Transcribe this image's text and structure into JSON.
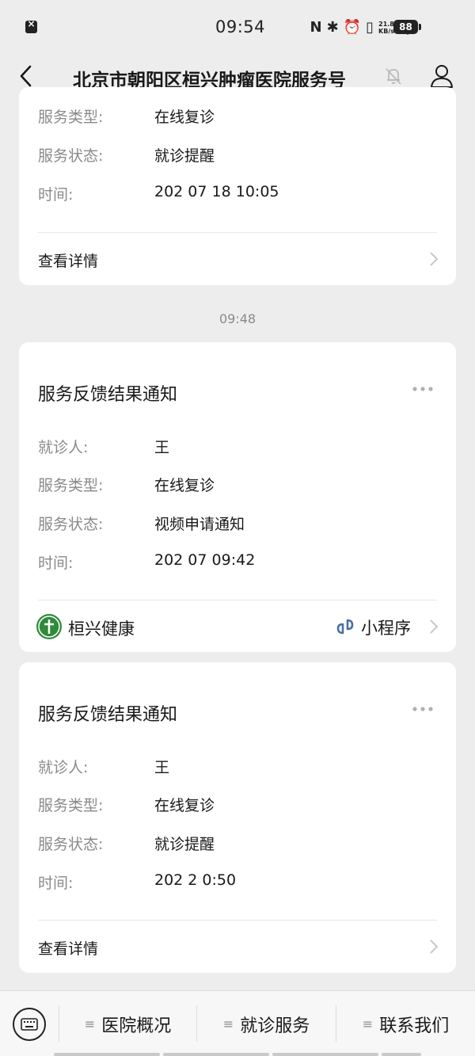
{
  "status_bar": {
    "time": "09:54",
    "network_speed": "21.8",
    "network_unit": "KB/s",
    "battery": "88"
  },
  "nav": {
    "title": "北京市朝阳区桓兴肿瘤医院服务号"
  },
  "cards": [
    {
      "fields": [
        {
          "label": "服务类型:",
          "value": "在线复诊"
        },
        {
          "label": "服务状态:",
          "value": "就诊提醒"
        },
        {
          "label": "时间:",
          "value": "202  07 18 10:05"
        }
      ],
      "footer": "查看详情"
    },
    {
      "timestamp": "09:48",
      "title": "服务反馈结果通知",
      "fields": [
        {
          "label": "就诊人:",
          "value": "王"
        },
        {
          "label": "服务类型:",
          "value": "在线复诊"
        },
        {
          "label": "服务状态:",
          "value": "视频申请通知"
        },
        {
          "label": "时间:",
          "value": "202  07  09:42"
        }
      ],
      "mini_program": {
        "name": "桓兴健康",
        "tag": "小程序"
      }
    },
    {
      "title": "服务反馈结果通知",
      "fields": [
        {
          "label": "就诊人:",
          "value": "王"
        },
        {
          "label": "服务类型:",
          "value": "在线复诊"
        },
        {
          "label": "服务状态:",
          "value": "就诊提醒"
        },
        {
          "label": "时间:",
          "value": "202  2  0:50"
        }
      ],
      "footer": "查看详情"
    }
  ],
  "bottom_menu": {
    "items": [
      {
        "label": "医院概况"
      },
      {
        "label": "就诊服务"
      },
      {
        "label": "联系我们"
      }
    ]
  },
  "colors": {
    "background": "#ededed",
    "card": "#ffffff",
    "label_gray": "#8a8a8a",
    "text": "#191919",
    "link_blue": "#4a6fa5"
  }
}
